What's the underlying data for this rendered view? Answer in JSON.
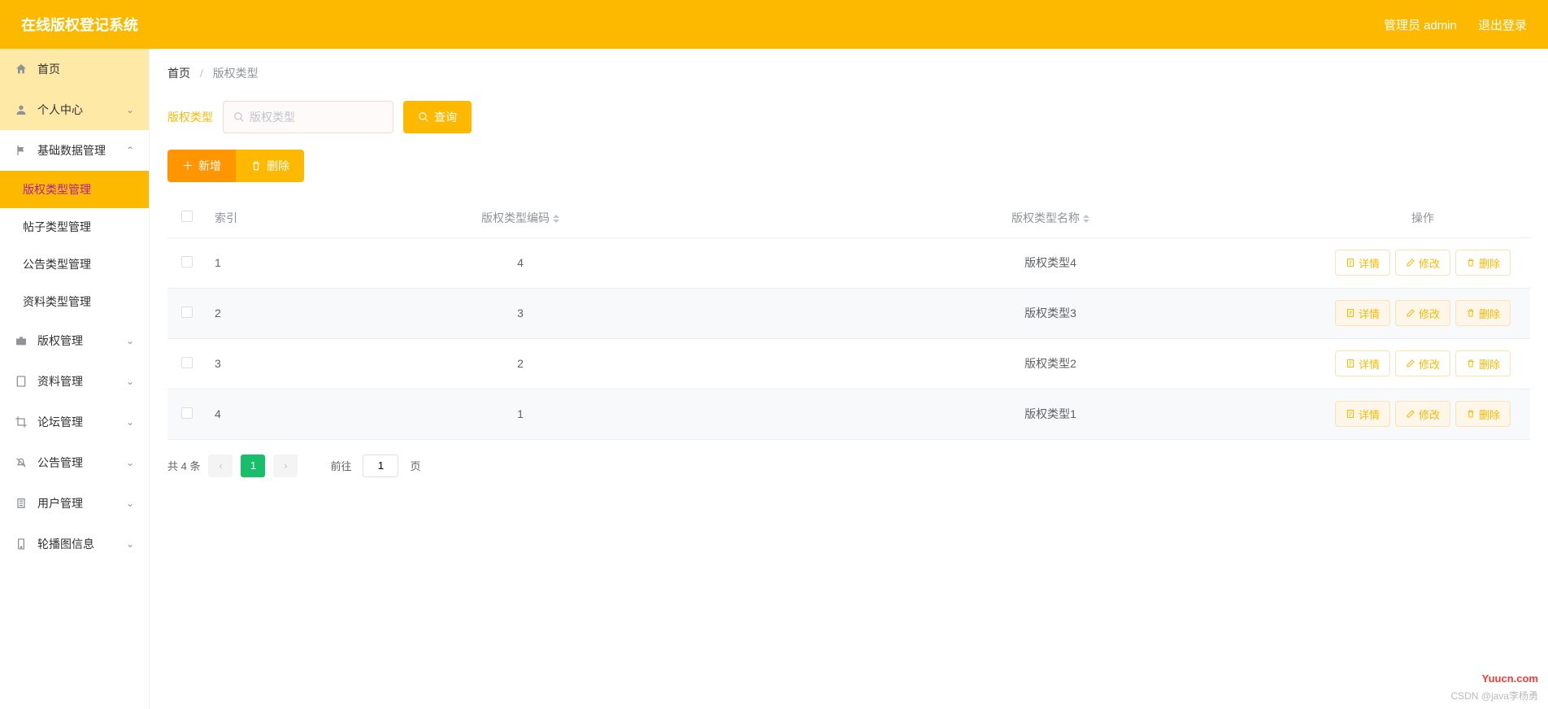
{
  "header": {
    "title": "在线版权登记系统",
    "user_label": "管理员 admin",
    "logout_label": "退出登录"
  },
  "sidebar": {
    "home": "首页",
    "personal": "个人中心",
    "basic_data": "基础数据管理",
    "sub": {
      "copyright_type": "版权类型管理",
      "post_type": "帖子类型管理",
      "notice_type": "公告类型管理",
      "material_type": "资料类型管理"
    },
    "copyright_mgmt": "版权管理",
    "material_mgmt": "资料管理",
    "forum_mgmt": "论坛管理",
    "notice_mgmt": "公告管理",
    "user_mgmt": "用户管理",
    "carousel_mgmt": "轮播图信息"
  },
  "breadcrumb": {
    "home": "首页",
    "current": "版权类型"
  },
  "filter": {
    "label": "版权类型",
    "placeholder": "版权类型",
    "search_btn": "查询"
  },
  "actions": {
    "add": "新增",
    "delete": "删除"
  },
  "table": {
    "headers": {
      "index": "索引",
      "code": "版权类型编码",
      "name": "版权类型名称",
      "ops": "操作"
    },
    "ops": {
      "detail": "详情",
      "edit": "修改",
      "delete": "删除"
    },
    "rows": [
      {
        "index": "1",
        "code": "4",
        "name": "版权类型4"
      },
      {
        "index": "2",
        "code": "3",
        "name": "版权类型3"
      },
      {
        "index": "3",
        "code": "2",
        "name": "版权类型2"
      },
      {
        "index": "4",
        "code": "1",
        "name": "版权类型1"
      }
    ]
  },
  "pagination": {
    "total": "共 4 条",
    "current": "1",
    "goto_prefix": "前往",
    "goto_value": "1",
    "goto_suffix": "页"
  },
  "watermark": "Yuucn.com",
  "credit": "CSDN @java李杨勇"
}
